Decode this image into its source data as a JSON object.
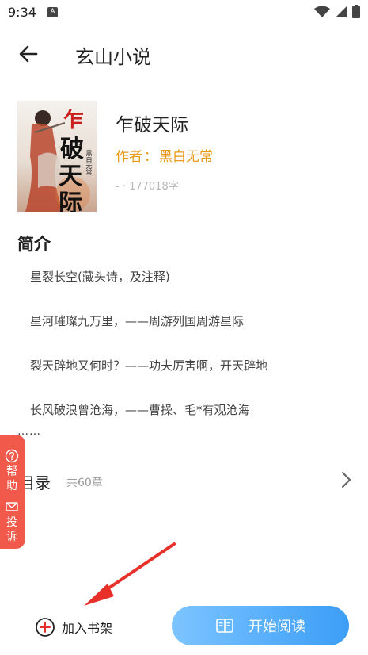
{
  "status": {
    "time": "9:34",
    "badge": "A"
  },
  "app_bar": {
    "title": "玄山小说"
  },
  "book": {
    "title": "乍破天际",
    "author_label": "作者",
    "author_sep": "：",
    "author_name": "黑白无常",
    "words": "- · 177018字",
    "cover_title_chars": [
      "乍",
      "破",
      "天",
      "际"
    ],
    "cover_author": "黑白无常"
  },
  "intro": {
    "heading": "简介",
    "lines": [
      "星裂长空(藏头诗，及注释)",
      "星河璀璨九万里，——周游列国周游星际",
      "裂天辟地又何时？——功夫厉害啊，开天辟地",
      "长风破浪曾沧海，——曹操、毛*有观沧海"
    ],
    "more": "……"
  },
  "toc": {
    "label": "目录",
    "count": "共60章"
  },
  "side_tab": {
    "help": [
      "帮",
      "助"
    ],
    "complain": [
      "投",
      "诉"
    ]
  },
  "actions": {
    "add_shelf": "加入书架",
    "start_read": "开始阅读"
  },
  "colors": {
    "author": "#e89a18",
    "side_tab": "#f1594a",
    "read_start": "#7cc4ff",
    "read_end": "#3b9ef6",
    "arrow": "#e8302a",
    "add_shelf_icon": "#e8302a"
  }
}
